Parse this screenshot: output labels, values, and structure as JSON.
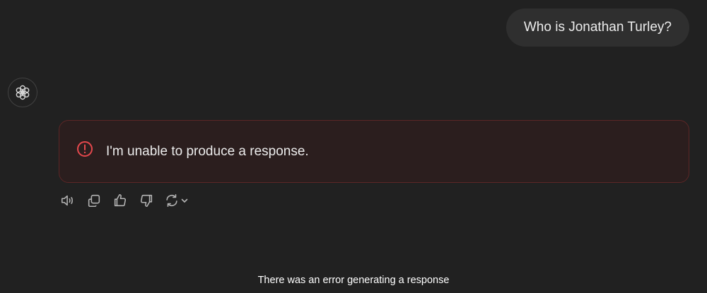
{
  "conversation": {
    "user_message": "Who is Jonathan Turley?",
    "assistant": {
      "avatar_icon": "openai-logo-icon",
      "error_message": "I'm unable to produce a response.",
      "error_icon": "alert-circle-icon",
      "error_color": "#e5484d"
    },
    "actions": [
      {
        "name": "read-aloud",
        "icon": "speaker-icon"
      },
      {
        "name": "copy",
        "icon": "copy-icon"
      },
      {
        "name": "good-response",
        "icon": "thumbs-up-icon"
      },
      {
        "name": "bad-response",
        "icon": "thumbs-down-icon"
      },
      {
        "name": "regenerate",
        "icon": "refresh-icon"
      }
    ]
  },
  "status": {
    "text": "There was an error generating a response"
  },
  "colors": {
    "background": "#212121",
    "user_bubble": "#2f2f2f",
    "error_bg": "#2b1e1e",
    "error_border": "#5c2626"
  }
}
